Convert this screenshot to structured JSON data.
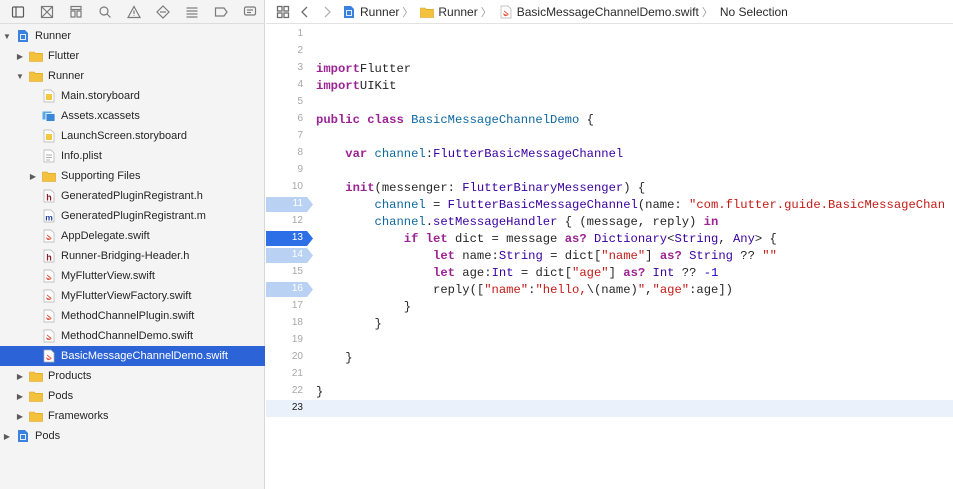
{
  "navigator": {
    "toolbar_icons": [
      "project-navigator-icon",
      "source-control-icon",
      "symbol-navigator-icon",
      "find-icon",
      "issue-icon",
      "test-icon",
      "debug-icon",
      "breakpoint-icon",
      "report-icon"
    ],
    "items": [
      {
        "label": "Runner",
        "kind": "project",
        "depth": 0,
        "disclosure": "open"
      },
      {
        "label": "Flutter",
        "kind": "folder",
        "depth": 1,
        "disclosure": "closed"
      },
      {
        "label": "Runner",
        "kind": "folder",
        "depth": 1,
        "disclosure": "open"
      },
      {
        "label": "Main.storyboard",
        "kind": "storyboard",
        "depth": 2,
        "disclosure": "none"
      },
      {
        "label": "Assets.xcassets",
        "kind": "assets",
        "depth": 2,
        "disclosure": "none"
      },
      {
        "label": "LaunchScreen.storyboard",
        "kind": "storyboard",
        "depth": 2,
        "disclosure": "none"
      },
      {
        "label": "Info.plist",
        "kind": "plist",
        "depth": 2,
        "disclosure": "none"
      },
      {
        "label": "Supporting Files",
        "kind": "folder",
        "depth": 2,
        "disclosure": "closed"
      },
      {
        "label": "GeneratedPluginRegistrant.h",
        "kind": "header",
        "depth": 2,
        "disclosure": "none"
      },
      {
        "label": "GeneratedPluginRegistrant.m",
        "kind": "objc",
        "depth": 2,
        "disclosure": "none"
      },
      {
        "label": "AppDelegate.swift",
        "kind": "swift",
        "depth": 2,
        "disclosure": "none"
      },
      {
        "label": "Runner-Bridging-Header.h",
        "kind": "header",
        "depth": 2,
        "disclosure": "none"
      },
      {
        "label": "MyFlutterView.swift",
        "kind": "swift",
        "depth": 2,
        "disclosure": "none"
      },
      {
        "label": "MyFlutterViewFactory.swift",
        "kind": "swift",
        "depth": 2,
        "disclosure": "none"
      },
      {
        "label": "MethodChannelPlugin.swift",
        "kind": "swift",
        "depth": 2,
        "disclosure": "none"
      },
      {
        "label": "MethodChannelDemo.swift",
        "kind": "swift",
        "depth": 2,
        "disclosure": "none"
      },
      {
        "label": "BasicMessageChannelDemo.swift",
        "kind": "swift",
        "depth": 2,
        "disclosure": "none",
        "selected": true
      },
      {
        "label": "Products",
        "kind": "folder",
        "depth": 1,
        "disclosure": "closed"
      },
      {
        "label": "Pods",
        "kind": "folder",
        "depth": 1,
        "disclosure": "closed"
      },
      {
        "label": "Frameworks",
        "kind": "folder",
        "depth": 1,
        "disclosure": "closed"
      },
      {
        "label": "Pods",
        "kind": "project",
        "depth": 0,
        "disclosure": "closed"
      }
    ]
  },
  "jumpbar": {
    "crumbs": [
      {
        "label": "Runner",
        "kind": "project"
      },
      {
        "label": "Runner",
        "kind": "folder"
      },
      {
        "label": "BasicMessageChannelDemo.swift",
        "kind": "swift"
      },
      {
        "label": "No Selection",
        "kind": "none"
      }
    ]
  },
  "editor": {
    "current_line": 23,
    "lines": [
      {
        "n": "1",
        "bp": "",
        "tokens": []
      },
      {
        "n": "2",
        "bp": "",
        "tokens": []
      },
      {
        "n": "3",
        "bp": "",
        "tokens": [
          [
            "kw",
            "import"
          ],
          [
            "",
            "Flutter"
          ]
        ]
      },
      {
        "n": "4",
        "bp": "",
        "tokens": [
          [
            "kw",
            "import"
          ],
          [
            "",
            "UIKit"
          ]
        ]
      },
      {
        "n": "5",
        "bp": "",
        "tokens": []
      },
      {
        "n": "6",
        "bp": "",
        "tokens": [
          [
            "kw",
            "public class"
          ],
          [
            "",
            " "
          ],
          [
            "pr",
            "BasicMessageChannelDemo"
          ],
          [
            "",
            " {"
          ]
        ]
      },
      {
        "n": "7",
        "bp": "",
        "tokens": []
      },
      {
        "n": "8",
        "bp": "",
        "tokens": [
          [
            "",
            "    "
          ],
          [
            "kw",
            "var"
          ],
          [
            "",
            " "
          ],
          [
            "pr",
            "channel"
          ],
          [
            "",
            ":"
          ],
          [
            "ty",
            "FlutterBasicMessageChannel"
          ]
        ]
      },
      {
        "n": "9",
        "bp": "",
        "tokens": []
      },
      {
        "n": "10",
        "bp": "",
        "tokens": [
          [
            "",
            "    "
          ],
          [
            "kw",
            "init"
          ],
          [
            "",
            "(messenger: "
          ],
          [
            "ty",
            "FlutterBinaryMessenger"
          ],
          [
            "",
            ") {"
          ]
        ]
      },
      {
        "n": "11",
        "bp": "inactive",
        "tokens": [
          [
            "",
            "        "
          ],
          [
            "pr",
            "channel"
          ],
          [
            "",
            " = "
          ],
          [
            "ty",
            "FlutterBasicMessageChannel"
          ],
          [
            "",
            "(name: "
          ],
          [
            "st",
            "\"com.flutter.guide.BasicMessageChan"
          ]
        ]
      },
      {
        "n": "12",
        "bp": "",
        "tokens": [
          [
            "",
            "        "
          ],
          [
            "pr",
            "channel"
          ],
          [
            "",
            "."
          ],
          [
            "ty",
            "setMessageHandler"
          ],
          [
            "",
            " { (message, reply) "
          ],
          [
            "kw",
            "in"
          ]
        ]
      },
      {
        "n": "13",
        "bp": "active",
        "tokens": [
          [
            "",
            "            "
          ],
          [
            "kw",
            "if let"
          ],
          [
            "",
            " dict = message "
          ],
          [
            "kw",
            "as?"
          ],
          [
            "",
            " "
          ],
          [
            "ty",
            "Dictionary"
          ],
          [
            "",
            "<"
          ],
          [
            "ty",
            "String"
          ],
          [
            "",
            ", "
          ],
          [
            "ty",
            "Any"
          ],
          [
            "",
            "> {"
          ]
        ]
      },
      {
        "n": "14",
        "bp": "inactive",
        "tokens": [
          [
            "",
            "                "
          ],
          [
            "kw",
            "let"
          ],
          [
            "",
            " name:"
          ],
          [
            "ty",
            "String"
          ],
          [
            "",
            " = dict["
          ],
          [
            "st",
            "\"name\""
          ],
          [
            "",
            "] "
          ],
          [
            "kw",
            "as?"
          ],
          [
            "",
            " "
          ],
          [
            "ty",
            "String"
          ],
          [
            "",
            " ?? "
          ],
          [
            "st",
            "\"\""
          ]
        ]
      },
      {
        "n": "15",
        "bp": "",
        "tokens": [
          [
            "",
            "                "
          ],
          [
            "kw",
            "let"
          ],
          [
            "",
            " age:"
          ],
          [
            "ty",
            "Int"
          ],
          [
            "",
            " = dict["
          ],
          [
            "st",
            "\"age\""
          ],
          [
            "",
            "] "
          ],
          [
            "kw",
            "as?"
          ],
          [
            "",
            " "
          ],
          [
            "ty",
            "Int"
          ],
          [
            "",
            " ?? "
          ],
          [
            "nm",
            "-1"
          ]
        ]
      },
      {
        "n": "16",
        "bp": "inactive",
        "tokens": [
          [
            "",
            "                reply(["
          ],
          [
            "st",
            "\"name\""
          ],
          [
            "",
            ":"
          ],
          [
            "st",
            "\"hello,"
          ],
          [
            "",
            "\\(name)"
          ],
          [
            "st",
            "\""
          ],
          [
            "",
            ","
          ],
          [
            "st",
            "\"age\""
          ],
          [
            "",
            ":age])"
          ]
        ]
      },
      {
        "n": "17",
        "bp": "",
        "tokens": [
          [
            "",
            "            }"
          ]
        ]
      },
      {
        "n": "18",
        "bp": "",
        "tokens": [
          [
            "",
            "        }"
          ]
        ]
      },
      {
        "n": "19",
        "bp": "",
        "tokens": []
      },
      {
        "n": "20",
        "bp": "",
        "tokens": [
          [
            "",
            "    }"
          ]
        ]
      },
      {
        "n": "21",
        "bp": "",
        "tokens": []
      },
      {
        "n": "22",
        "bp": "",
        "tokens": [
          [
            "",
            "}"
          ]
        ]
      },
      {
        "n": "23",
        "bp": "",
        "tokens": []
      }
    ]
  },
  "colors": {
    "selection": "#2c63d6",
    "breakpoint_active": "#2d6fe6",
    "breakpoint_inactive": "#b9d1f2",
    "keyword": "#9b2393",
    "type": "#3900a0",
    "string": "#c41a16",
    "folder": "#f4c13d"
  }
}
